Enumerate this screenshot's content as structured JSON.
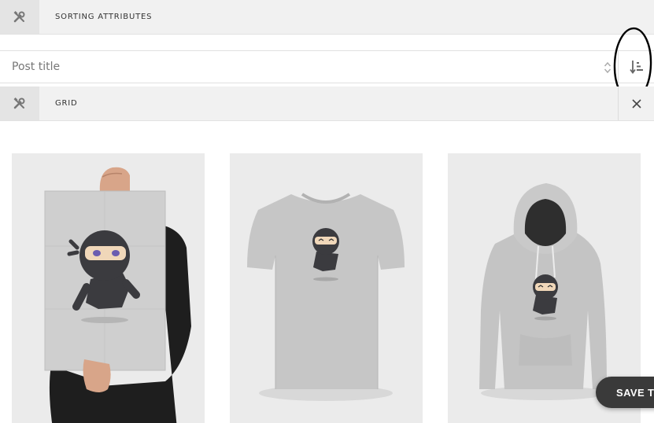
{
  "sorting_bar": {
    "label": "SORTING ATTRIBUTES",
    "icon": "wrench-screwdriver-icon"
  },
  "sort_select": {
    "value": "Post title",
    "arrows_icon": "select-arrows-icon",
    "order_icon": "sort-descending-icon"
  },
  "grid_bar": {
    "label": "GRID",
    "icon": "wrench-screwdriver-icon",
    "close_icon": "close-icon"
  },
  "products": [
    {
      "name": "poster",
      "image": "ninja-poster-image"
    },
    {
      "name": "t-shirt",
      "image": "ninja-tshirt-image"
    },
    {
      "name": "hoodie",
      "image": "ninja-hoodie-image"
    }
  ],
  "save_button": {
    "label": "SAVE TI"
  },
  "colors": {
    "bar_bg": "#f1f1f1",
    "tool_bg": "#e4e4e4",
    "card_bg": "#ebebeb",
    "save_bg": "#3a3a3a"
  }
}
